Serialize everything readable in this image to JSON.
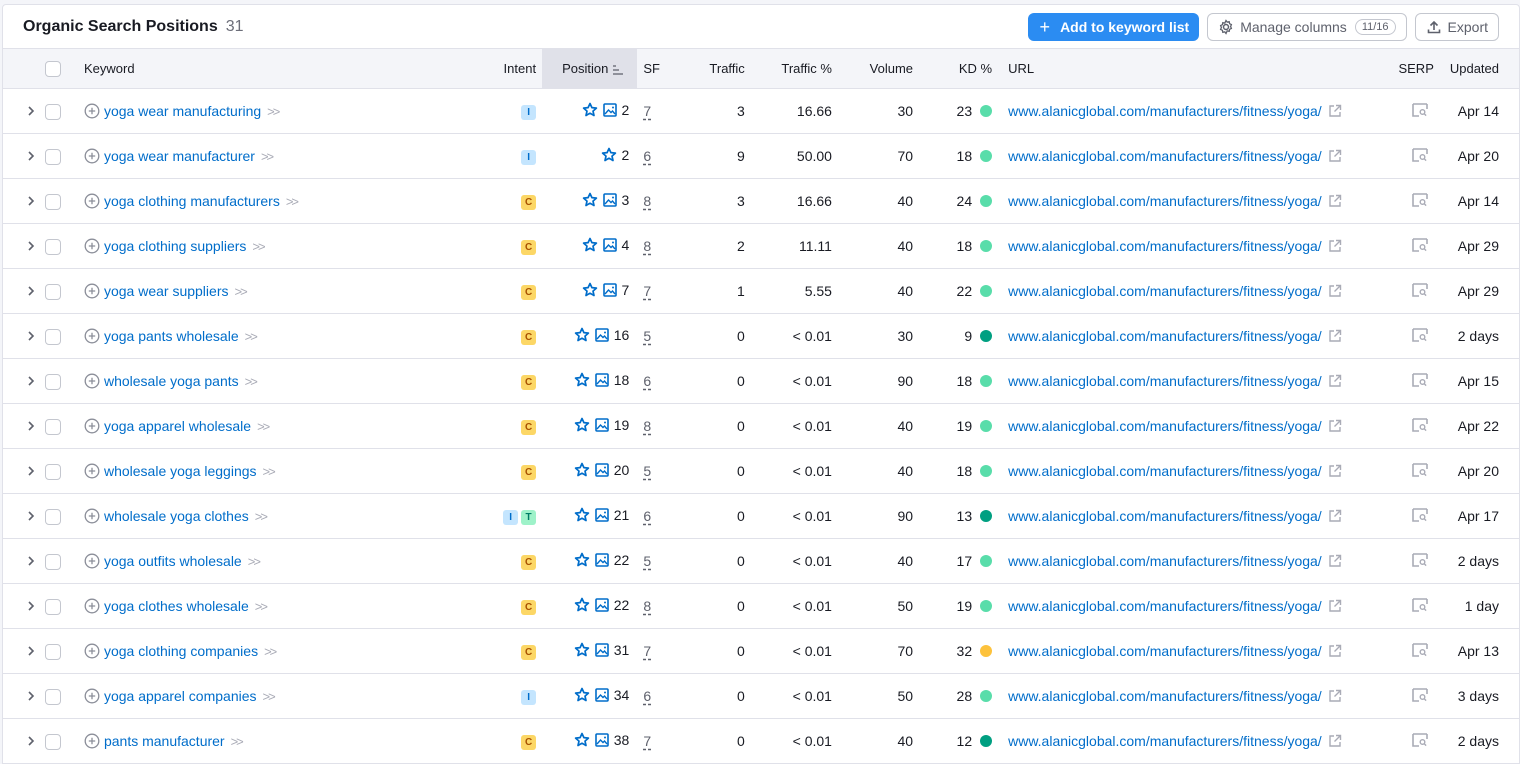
{
  "header": {
    "title": "Organic Search Positions",
    "count": "31",
    "add_button": "Add to keyword list",
    "manage_button": "Manage columns",
    "manage_count": "11/16",
    "export_button": "Export"
  },
  "columns": {
    "keyword": "Keyword",
    "intent": "Intent",
    "position": "Position",
    "sf": "SF",
    "traffic": "Traffic",
    "traffic_pct": "Traffic %",
    "volume": "Volume",
    "kd": "KD %",
    "url": "URL",
    "serp": "SERP",
    "updated": "Updated"
  },
  "colors": {
    "accent": "#2b8cf2",
    "link": "#006dca",
    "kd_easy": "#59ddaa",
    "kd_very_easy": "#009f81",
    "kd_possible": "#fdc23c"
  },
  "rows": [
    {
      "keyword": "yoga wear manufacturing",
      "intent": [
        "I"
      ],
      "star": true,
      "image": true,
      "position": "2",
      "sf": "7",
      "traffic": "3",
      "traffic_pct": "16.66",
      "volume": "30",
      "kd": "23",
      "kd_level": "easy",
      "url": "www.alanicglobal.com/manufacturers/fitness/yoga/",
      "updated": "Apr 14"
    },
    {
      "keyword": "yoga wear manufacturer",
      "intent": [
        "I"
      ],
      "star": true,
      "image": false,
      "position": "2",
      "sf": "6",
      "traffic": "9",
      "traffic_pct": "50.00",
      "volume": "70",
      "kd": "18",
      "kd_level": "easy",
      "url": "www.alanicglobal.com/manufacturers/fitness/yoga/",
      "updated": "Apr 20"
    },
    {
      "keyword": "yoga clothing manufacturers",
      "intent": [
        "C"
      ],
      "star": true,
      "image": true,
      "position": "3",
      "sf": "8",
      "traffic": "3",
      "traffic_pct": "16.66",
      "volume": "40",
      "kd": "24",
      "kd_level": "easy",
      "url": "www.alanicglobal.com/manufacturers/fitness/yoga/",
      "updated": "Apr 14"
    },
    {
      "keyword": "yoga clothing suppliers",
      "intent": [
        "C"
      ],
      "star": true,
      "image": true,
      "position": "4",
      "sf": "8",
      "traffic": "2",
      "traffic_pct": "11.11",
      "volume": "40",
      "kd": "18",
      "kd_level": "easy",
      "url": "www.alanicglobal.com/manufacturers/fitness/yoga/",
      "updated": "Apr 29"
    },
    {
      "keyword": "yoga wear suppliers",
      "intent": [
        "C"
      ],
      "star": true,
      "image": true,
      "position": "7",
      "sf": "7",
      "traffic": "1",
      "traffic_pct": "5.55",
      "volume": "40",
      "kd": "22",
      "kd_level": "easy",
      "url": "www.alanicglobal.com/manufacturers/fitness/yoga/",
      "updated": "Apr 29"
    },
    {
      "keyword": "yoga pants wholesale",
      "intent": [
        "C"
      ],
      "star": true,
      "image": true,
      "position": "16",
      "sf": "5",
      "traffic": "0",
      "traffic_pct": "< 0.01",
      "volume": "30",
      "kd": "9",
      "kd_level": "very_easy",
      "url": "www.alanicglobal.com/manufacturers/fitness/yoga/",
      "updated": "2 days"
    },
    {
      "keyword": "wholesale yoga pants",
      "intent": [
        "C"
      ],
      "star": true,
      "image": true,
      "position": "18",
      "sf": "6",
      "traffic": "0",
      "traffic_pct": "< 0.01",
      "volume": "90",
      "kd": "18",
      "kd_level": "easy",
      "url": "www.alanicglobal.com/manufacturers/fitness/yoga/",
      "updated": "Apr 15"
    },
    {
      "keyword": "yoga apparel wholesale",
      "intent": [
        "C"
      ],
      "star": true,
      "image": true,
      "position": "19",
      "sf": "8",
      "traffic": "0",
      "traffic_pct": "< 0.01",
      "volume": "40",
      "kd": "19",
      "kd_level": "easy",
      "url": "www.alanicglobal.com/manufacturers/fitness/yoga/",
      "updated": "Apr 22"
    },
    {
      "keyword": "wholesale yoga leggings",
      "intent": [
        "C"
      ],
      "star": true,
      "image": true,
      "position": "20",
      "sf": "5",
      "traffic": "0",
      "traffic_pct": "< 0.01",
      "volume": "40",
      "kd": "18",
      "kd_level": "easy",
      "url": "www.alanicglobal.com/manufacturers/fitness/yoga/",
      "updated": "Apr 20"
    },
    {
      "keyword": "wholesale yoga clothes",
      "intent": [
        "I",
        "T"
      ],
      "star": true,
      "image": true,
      "position": "21",
      "sf": "6",
      "traffic": "0",
      "traffic_pct": "< 0.01",
      "volume": "90",
      "kd": "13",
      "kd_level": "very_easy",
      "url": "www.alanicglobal.com/manufacturers/fitness/yoga/",
      "updated": "Apr 17"
    },
    {
      "keyword": "yoga outfits wholesale",
      "intent": [
        "C"
      ],
      "star": true,
      "image": true,
      "position": "22",
      "sf": "5",
      "traffic": "0",
      "traffic_pct": "< 0.01",
      "volume": "40",
      "kd": "17",
      "kd_level": "easy",
      "url": "www.alanicglobal.com/manufacturers/fitness/yoga/",
      "updated": "2 days"
    },
    {
      "keyword": "yoga clothes wholesale",
      "intent": [
        "C"
      ],
      "star": true,
      "image": true,
      "position": "22",
      "sf": "8",
      "traffic": "0",
      "traffic_pct": "< 0.01",
      "volume": "50",
      "kd": "19",
      "kd_level": "easy",
      "url": "www.alanicglobal.com/manufacturers/fitness/yoga/",
      "updated": "1 day"
    },
    {
      "keyword": "yoga clothing companies",
      "intent": [
        "C"
      ],
      "star": true,
      "image": true,
      "position": "31",
      "sf": "7",
      "traffic": "0",
      "traffic_pct": "< 0.01",
      "volume": "70",
      "kd": "32",
      "kd_level": "possible",
      "url": "www.alanicglobal.com/manufacturers/fitness/yoga/",
      "updated": "Apr 13"
    },
    {
      "keyword": "yoga apparel companies",
      "intent": [
        "I"
      ],
      "star": true,
      "image": true,
      "position": "34",
      "sf": "6",
      "traffic": "0",
      "traffic_pct": "< 0.01",
      "volume": "50",
      "kd": "28",
      "kd_level": "easy",
      "url": "www.alanicglobal.com/manufacturers/fitness/yoga/",
      "updated": "3 days"
    },
    {
      "keyword": "pants manufacturer",
      "intent": [
        "C"
      ],
      "star": true,
      "image": true,
      "position": "38",
      "sf": "7",
      "traffic": "0",
      "traffic_pct": "< 0.01",
      "volume": "40",
      "kd": "12",
      "kd_level": "very_easy",
      "url": "www.alanicglobal.com/manufacturers/fitness/yoga/",
      "updated": "2 days"
    }
  ]
}
